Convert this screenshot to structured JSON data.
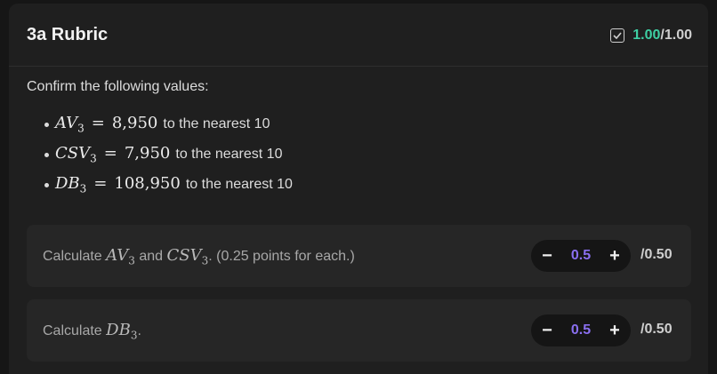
{
  "rubric": {
    "title": "3a Rubric",
    "score_earned": "1.00",
    "score_total": "/1.00",
    "prompt": "Confirm the following values:",
    "values": [
      {
        "symbol": "AV",
        "sub": "3",
        "eq": "=",
        "value": "8,950",
        "suffix": "to the nearest 10"
      },
      {
        "symbol": "CSV",
        "sub": "3",
        "eq": "=",
        "value": "7,950",
        "suffix": "to the nearest 10"
      },
      {
        "symbol": "DB",
        "sub": "3",
        "eq": "=",
        "value": "108,950",
        "suffix": "to the nearest 10"
      }
    ],
    "items": [
      {
        "text_1": "Calculate ",
        "sym_a": "AV",
        "sub_a": "3",
        "text_2": " and ",
        "sym_b": "CSV",
        "sub_b": "3",
        "text_3": ". (0.25 points for each.)",
        "minus": "−",
        "value": "0.5",
        "plus": "+",
        "out_of": "/0.50"
      },
      {
        "text_1": "Calculate ",
        "sym_a": "DB",
        "sub_a": "3",
        "text_2": ".",
        "minus": "−",
        "value": "0.5",
        "plus": "+",
        "out_of": "/0.50"
      }
    ]
  },
  "colors": {
    "accent_score": "#3ecfa3",
    "accent_value": "#8a6ff0",
    "background": "#161616",
    "card": "#1f1f1f"
  },
  "icons": {
    "score_icon": "checkbox-checked-icon"
  }
}
